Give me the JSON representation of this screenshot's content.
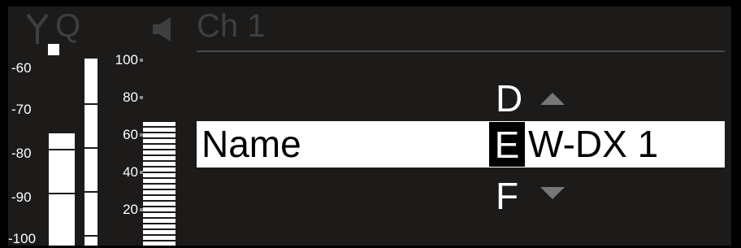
{
  "header": {
    "q_label": "Q",
    "channel_label": "Ch 1"
  },
  "rf_scale": [
    "-60",
    "-70",
    "-80",
    "-90",
    "-100"
  ],
  "af_scale": [
    "100",
    "80",
    "60",
    "40",
    "20"
  ],
  "editor": {
    "field_label": "Name",
    "char_above": "D",
    "cursor_char": "E",
    "rest_value": "W-DX 1",
    "char_below": "F"
  },
  "colors": {
    "background": "#1d1a1a",
    "inactive": "#3f3f3f",
    "foreground": "#ffffff",
    "arrow": "#777777"
  },
  "icons": {
    "antenna": "antenna-icon",
    "speaker": "speaker-icon"
  }
}
